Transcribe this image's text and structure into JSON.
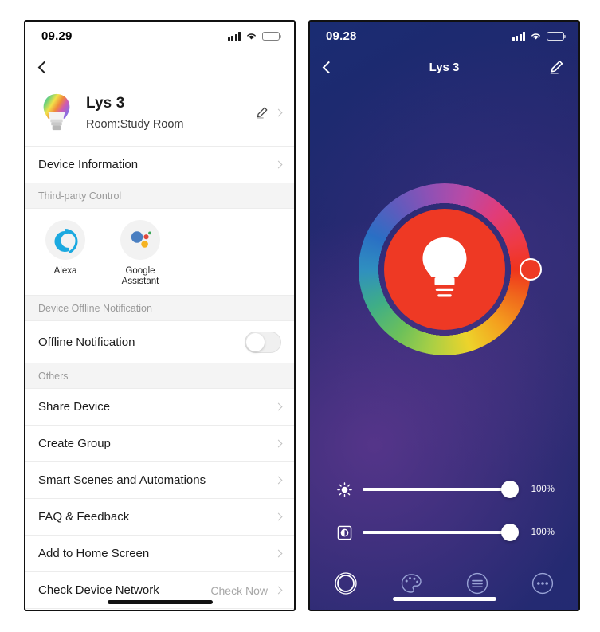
{
  "left_screen": {
    "status": {
      "time": "09.29",
      "cellular": "signal-bars-icon",
      "wifi": "wifi-icon",
      "battery": "battery-icon"
    },
    "nav": {
      "back": "back-chevron-icon"
    },
    "device": {
      "icon": "smart-bulb-icon",
      "name": "Lys 3",
      "room": "Room:Study Room",
      "edit_icon": "pencil-icon",
      "chevron": "chevron-right-icon"
    },
    "device_information_row": {
      "label": "Device Information"
    },
    "third_party": {
      "section_title": "Third-party Control",
      "items": [
        {
          "label": "Alexa",
          "icon": "alexa-icon"
        },
        {
          "label": "Google Assistant",
          "icon": "google-assistant-icon"
        }
      ]
    },
    "offline": {
      "section_title": "Device Offline Notification",
      "row_label": "Offline Notification",
      "toggle_state": "off"
    },
    "others": {
      "section_title": "Others",
      "rows": [
        {
          "label": "Share Device",
          "value": ""
        },
        {
          "label": "Create Group",
          "value": ""
        },
        {
          "label": "Smart Scenes and Automations",
          "value": ""
        },
        {
          "label": "FAQ & Feedback",
          "value": ""
        },
        {
          "label": "Add to Home Screen",
          "value": ""
        },
        {
          "label": "Check Device Network",
          "value": "Check Now"
        }
      ]
    }
  },
  "right_screen": {
    "status": {
      "time": "09.28",
      "cellular": "signal-bars-icon",
      "wifi": "wifi-icon",
      "battery": "battery-icon"
    },
    "nav": {
      "back": "back-chevron-icon",
      "title": "Lys 3",
      "edit_icon": "pencil-icon"
    },
    "color_wheel": {
      "selected_color": "#ee3924",
      "handle_angle_deg": 0,
      "center_icon": "light-bulb-icon"
    },
    "sliders": [
      {
        "name": "brightness",
        "icon": "brightness-sun-icon",
        "value": "100%",
        "percent": 100
      },
      {
        "name": "color-temperature",
        "icon": "color-temperature-icon",
        "value": "100%",
        "percent": 100
      }
    ],
    "tabs": [
      {
        "name": "white-light",
        "icon": "circle-outline-icon",
        "active": true
      },
      {
        "name": "color-scene",
        "icon": "palette-icon",
        "active": false
      },
      {
        "name": "schedule",
        "icon": "list-lines-icon",
        "active": false
      },
      {
        "name": "more",
        "icon": "more-dots-icon",
        "active": false
      }
    ]
  },
  "theme": {
    "accent_red": "#ee3924",
    "dark_bg": "#22276d",
    "list_bg": "#ffffff",
    "section_bg": "#f4f4f4",
    "muted_text": "#9a9a9a"
  }
}
